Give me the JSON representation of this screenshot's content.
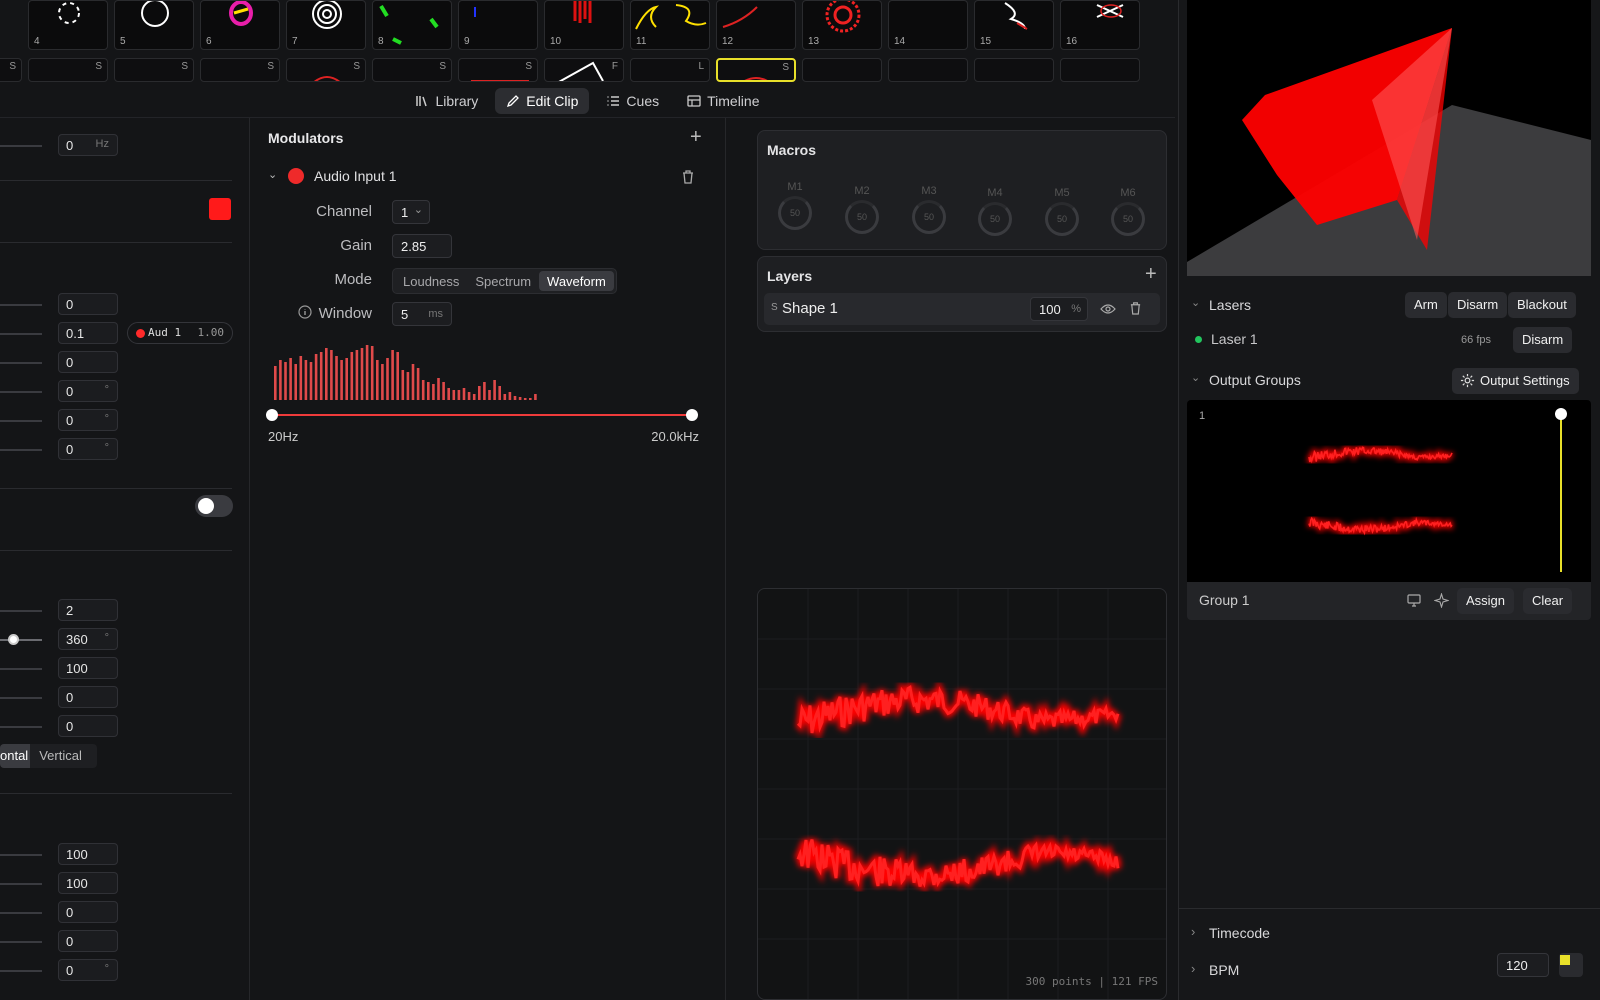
{
  "clips": {
    "row1": [
      {
        "num": "4"
      },
      {
        "num": "5"
      },
      {
        "num": "6"
      },
      {
        "num": "7"
      },
      {
        "num": "8"
      },
      {
        "num": "9"
      },
      {
        "num": "10"
      },
      {
        "num": "11"
      },
      {
        "num": "12"
      },
      {
        "num": "13"
      },
      {
        "num": "14"
      },
      {
        "num": "15"
      },
      {
        "num": "16"
      }
    ],
    "row2_tags": [
      "S",
      "S",
      "S",
      "S",
      "S",
      "S",
      "S",
      "F",
      "L",
      "S",
      "",
      "",
      "",
      ""
    ]
  },
  "tabs": [
    {
      "label": "Library",
      "icon": "library-icon"
    },
    {
      "label": "Edit Clip",
      "icon": "pencil-icon"
    },
    {
      "label": "Cues",
      "icon": "list-icon"
    },
    {
      "label": "Timeline",
      "icon": "timeline-icon"
    }
  ],
  "left": {
    "freq": {
      "value": "0",
      "unit": "Hz"
    },
    "group2": [
      {
        "value": "0",
        "unit": ""
      },
      {
        "value": "0.1",
        "unit": ""
      },
      {
        "value": "0",
        "unit": ""
      },
      {
        "value": "0",
        "unit": "°"
      },
      {
        "value": "0",
        "unit": "°"
      },
      {
        "value": "0",
        "unit": "°"
      }
    ],
    "mod_badge": {
      "name": "Aud 1",
      "amount": "1.00"
    },
    "group3": [
      {
        "value": "2",
        "unit": ""
      },
      {
        "value": "360",
        "unit": "°"
      },
      {
        "value": "100",
        "unit": ""
      },
      {
        "value": "0",
        "unit": ""
      },
      {
        "value": "0",
        "unit": ""
      }
    ],
    "orientation": {
      "left": "ontal",
      "right": "Vertical"
    },
    "group4": [
      {
        "value": "100",
        "unit": ""
      },
      {
        "value": "100",
        "unit": ""
      },
      {
        "value": "0",
        "unit": ""
      },
      {
        "value": "0",
        "unit": ""
      },
      {
        "value": "0",
        "unit": "°"
      }
    ]
  },
  "modulators": {
    "title": "Modulators",
    "item_name": "Audio Input 1",
    "channel_label": "Channel",
    "channel_value": "1",
    "gain_label": "Gain",
    "gain_value": "2.85",
    "mode_label": "Mode",
    "modes": [
      "Loudness",
      "Spectrum",
      "Waveform"
    ],
    "selected_mode": "Waveform",
    "window_label": "Window",
    "window_value": "5",
    "window_unit": "ms",
    "range_min": "20Hz",
    "range_max": "20.0kHz"
  },
  "macros": {
    "title": "Macros",
    "knobs": [
      {
        "label": "M1",
        "value": "50"
      },
      {
        "label": "M2",
        "value": "50"
      },
      {
        "label": "M3",
        "value": "50"
      },
      {
        "label": "M4",
        "value": "50"
      },
      {
        "label": "M5",
        "value": "50"
      },
      {
        "label": "M6",
        "value": "50"
      }
    ]
  },
  "layers": {
    "title": "Layers",
    "items": [
      {
        "badge": "S",
        "name": "Shape 1",
        "opacity": "100",
        "unit": "%"
      }
    ]
  },
  "preview": {
    "stats": "300 points | 121 FPS"
  },
  "right": {
    "lasers_title": "Lasers",
    "arm": "Arm",
    "disarm": "Disarm",
    "blackout": "Blackout",
    "laser_name": "Laser 1",
    "laser_fps": "66 fps",
    "laser_disarm": "Disarm",
    "output_groups_title": "Output Groups",
    "output_settings": "Output Settings",
    "group_index": "1",
    "group_name": "Group 1",
    "assign": "Assign",
    "clear": "Clear",
    "timecode": "Timecode",
    "bpm_label": "BPM",
    "bpm_value": "120"
  },
  "colors": {
    "accent_red": "#ff1a1a",
    "laser_green": "#22c55e",
    "highlight_yellow": "#e8e02a"
  }
}
